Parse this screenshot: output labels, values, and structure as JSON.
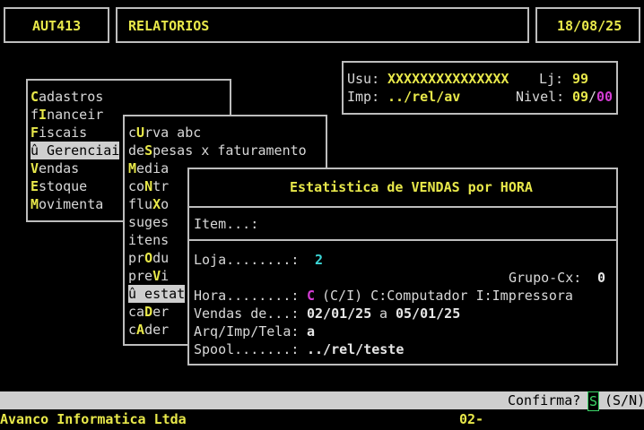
{
  "header": {
    "program": "AUT413",
    "title": "RELATORIOS",
    "date": "18/08/25"
  },
  "info": {
    "usu_label": "Usu:",
    "usu_value": "XXXXXXXXXXXXXXX",
    "lj_label": "Lj:",
    "lj_value": "99",
    "imp_label": "Imp:",
    "imp_value": "../rel/av",
    "nivel_label": "Nivel:",
    "nivel_value_a": "09",
    "nivel_sep": "/",
    "nivel_value_b": "00"
  },
  "main_menu": {
    "items": [
      {
        "pre": "",
        "key": "C",
        "post": "adastros"
      },
      {
        "pre": "f",
        "key": "I",
        "post": "nanceir"
      },
      {
        "pre": "",
        "key": "F",
        "post": "iscais"
      },
      {
        "pre": "û Gerenciai",
        "key": "",
        "post": ""
      },
      {
        "pre": "",
        "key": "V",
        "post": "endas"
      },
      {
        "pre": "",
        "key": "E",
        "post": "stoque"
      },
      {
        "pre": "",
        "key": "M",
        "post": "ovimenta"
      }
    ]
  },
  "sub_menu": {
    "items": [
      {
        "pre": "c",
        "key": "U",
        "post": "rva abc"
      },
      {
        "pre": "de",
        "key": "S",
        "post": "pesas x faturamento"
      },
      {
        "pre": "",
        "key": "M",
        "post": "edia"
      },
      {
        "pre": "co",
        "key": "N",
        "post": "tr"
      },
      {
        "pre": "flu",
        "key": "X",
        "post": "o"
      },
      {
        "pre": "suges",
        "key": "",
        "post": ""
      },
      {
        "pre": "itens",
        "key": "",
        "post": ""
      },
      {
        "pre": "pr",
        "key": "O",
        "post": "du"
      },
      {
        "pre": "pre",
        "key": "V",
        "post": "i"
      },
      {
        "pre": "û estat",
        "key": "",
        "post": ""
      },
      {
        "pre": "ca",
        "key": "D",
        "post": "er"
      },
      {
        "pre": "c",
        "key": "A",
        "post": "der"
      }
    ]
  },
  "dialog": {
    "title": "Estatistica de VENDAS por HORA",
    "item_label": "Item...:",
    "loja_label": "Loja........:",
    "loja_value": "2",
    "grupo_label": "Grupo-Cx:",
    "grupo_value": "0",
    "hora_label": "Hora........:",
    "hora_value": "C",
    "hora_hint": "(C/I) C:Computador I:Impressora",
    "vendas_label": "Vendas de...:",
    "vendas_from": "02/01/25",
    "vendas_a": "a",
    "vendas_to": "05/01/25",
    "arq_label": "Arq/Imp/Tela:",
    "arq_value": "a",
    "spool_label": "Spool.......:",
    "spool_value": "../rel/teste"
  },
  "status": {
    "prompt": "Confirma?",
    "value": "S",
    "options": "(S/N)"
  },
  "footer": {
    "company": "Avanco Informatica Ltda",
    "code": "02-"
  }
}
